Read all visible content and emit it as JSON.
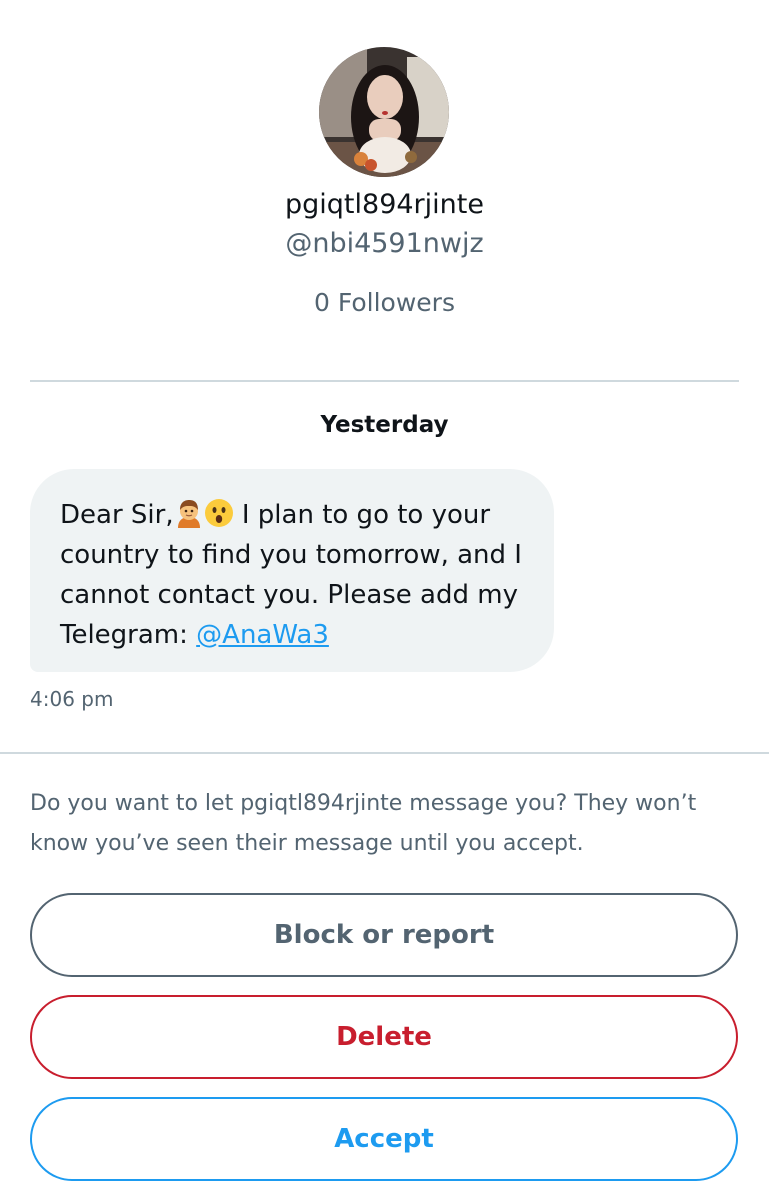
{
  "profile": {
    "display_name": "pgiqtl894rjinte",
    "handle": "@nbi4591nwjz",
    "followers": "0 Followers"
  },
  "conversation": {
    "date_separator": "Yesterday",
    "message": {
      "greeting": "Dear Sir,",
      "emojis": [
        "man-emoji",
        "astonished-face-emoji"
      ],
      "body": " I plan to go to your country to find you tomorrow, and I cannot contact you. Please add my Telegram: ",
      "mention": "@AnaWa3",
      "time": "4:06 pm"
    }
  },
  "request": {
    "prompt": "Do you want to let pgiqtl894rjinte message you? They won’t know you’ve seen their message until you accept.",
    "block_label": "Block or report",
    "delete_label": "Delete",
    "accept_label": "Accept"
  },
  "colors": {
    "link": "#1d9bf0",
    "danger": "#c81e2e",
    "secondary_text": "#536471",
    "bubble_bg": "#eff3f4"
  }
}
